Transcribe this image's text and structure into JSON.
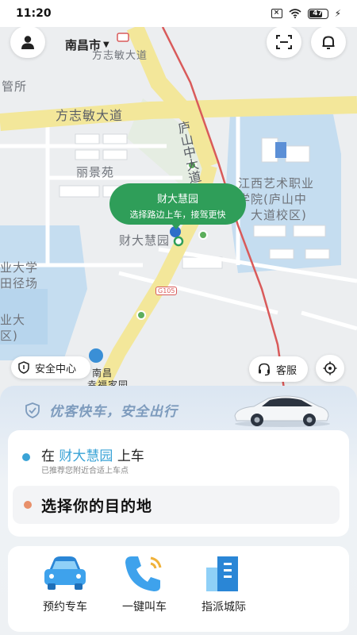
{
  "status_bar": {
    "time": "11:20",
    "battery": "47"
  },
  "header": {
    "city": "南昌市"
  },
  "map": {
    "labels": {
      "road_top": "方志敏大道",
      "road_mid": "方志敏大道",
      "road_vertical": "庐山中大道",
      "district_1": "管所",
      "district_2": "丽景苑",
      "district_3": "财大慧园",
      "school_1": "江西艺术职业",
      "school_2": "学院(庐山中",
      "school_3": "大道校区)",
      "left_1": "业大学",
      "left_2": "田径场",
      "left_3": "业大",
      "left_4": "区)",
      "poi_1": "南昌",
      "poi_2": "幸福家园",
      "road_badge": "G105"
    },
    "pickup_bubble": {
      "title": "财大慧园",
      "subtitle": "选择路边上车，接驾更快"
    }
  },
  "buttons": {
    "safety_center": "安全中心",
    "customer_service": "客服"
  },
  "panel": {
    "slogan": "优客快车，安全出行",
    "pickup_prefix": "在",
    "pickup_place": "财大慧园",
    "pickup_suffix": "上车",
    "pickup_hint": "已推荐您附近合适上车点",
    "destination_placeholder": "选择你的目的地"
  },
  "services": [
    {
      "label": "预约专车",
      "icon": "car-icon"
    },
    {
      "label": "一键叫车",
      "icon": "phone-icon"
    },
    {
      "label": "指派城际",
      "icon": "building-icon"
    }
  ],
  "colors": {
    "accent_green": "#2f9e59",
    "accent_blue": "#3aa3d6",
    "dest_dot": "#e8906a"
  }
}
